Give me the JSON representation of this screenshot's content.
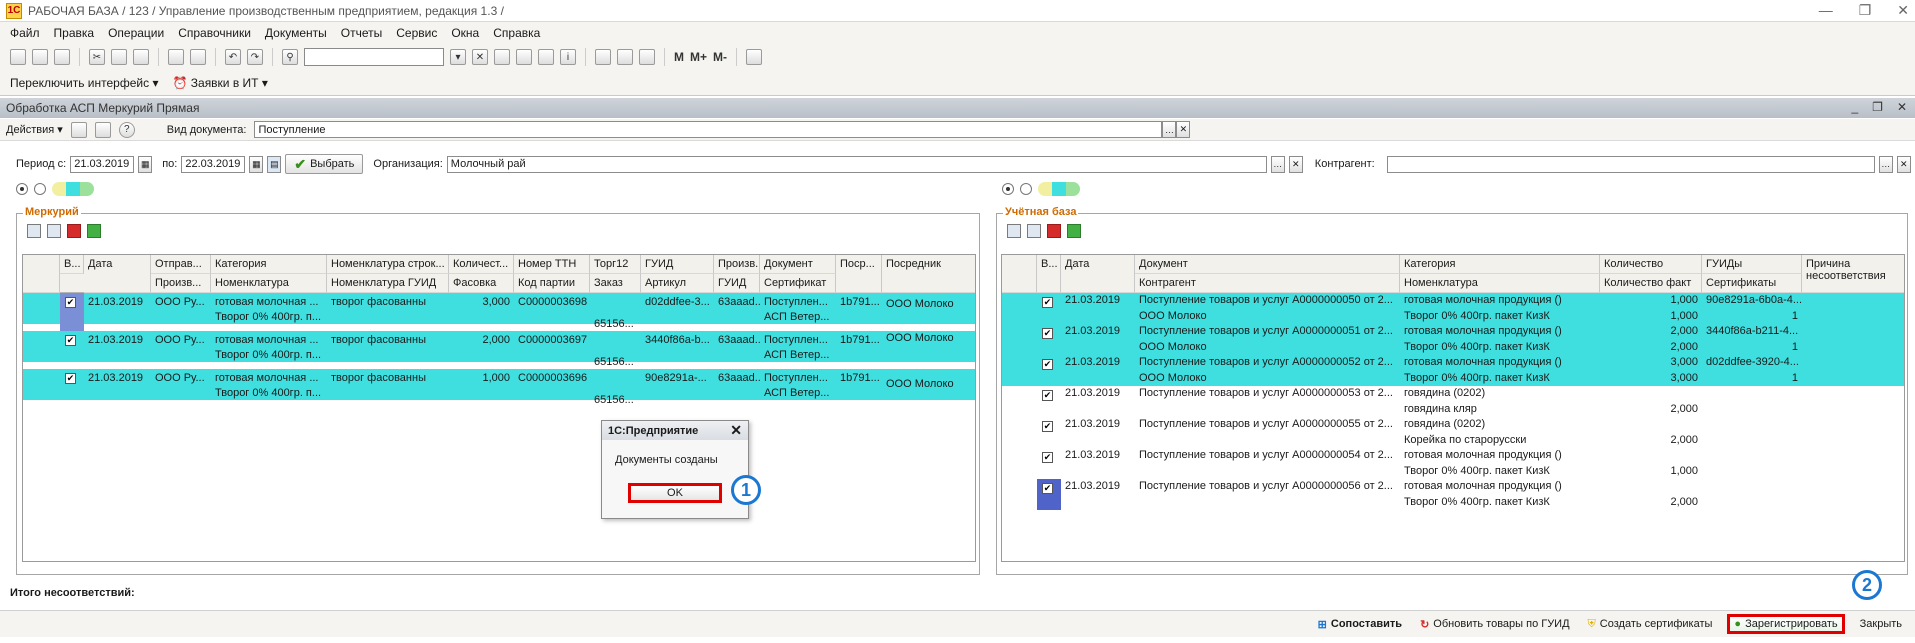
{
  "app": {
    "title": "РАБОЧАЯ БАЗА / 123 /  Управление производственным предприятием, редакция 1.3 /",
    "logo": "1С"
  },
  "menu": [
    "Файл",
    "Правка",
    "Операции",
    "Справочники",
    "Документы",
    "Отчеты",
    "Сервис",
    "Окна",
    "Справка"
  ],
  "toolbar2": {
    "switch_interface": "Переключить интерфейс",
    "requests_it": "Заявки в ИТ"
  },
  "toolbar_letters": [
    "M",
    "M+",
    "M-"
  ],
  "window": {
    "title": "Обработка  АСП Меркурий Прямая"
  },
  "actions": {
    "label": "Действия",
    "doc_type_label": "Вид документа:",
    "doc_type_value": "Поступление"
  },
  "period": {
    "from_label": "Период с:",
    "from_value": "21.03.2019",
    "to_label": "по:",
    "to_value": "22.03.2019",
    "select_button": "Выбрать",
    "org_label": "Организация:",
    "org_value": "Молочный рай",
    "contractor_label": "Контрагент:",
    "contractor_value": ""
  },
  "mercury": {
    "title": "Меркурий",
    "header_row1": [
      "В...",
      "Дата",
      "Отправ...",
      "Категория",
      "Номенклатура строк...",
      "Количест...",
      "Номер ТТН",
      "Торг12",
      "ГУИД",
      "Произв...",
      "Документ",
      "Поср...",
      "Посредник"
    ],
    "header_row2": [
      "Произв...",
      "Номенклатура",
      "Номенклатура ГУИД",
      "Фасовка",
      "Код партии",
      "Заказ",
      "Артикул",
      "ГУИД",
      "Сертификат"
    ],
    "rows": [
      {
        "date": "21.03.2019",
        "sender": "ООО Ру...",
        "category": "готовая молочная ...",
        "nom_str": "творог фасованны",
        "qty": "3,000",
        "ttn": "C0000003698",
        "guid": "d02ddfee-3...",
        "prod": "63aaad...",
        "doc": "Поступлен...",
        "posr": "1b791...",
        "mediator": "ООО Молоко",
        "nom": "Творог 0% 400гр. п...",
        "order": "65156...",
        "cert": "АСП Ветер..."
      },
      {
        "date": "21.03.2019",
        "sender": "ООО Ру...",
        "category": "готовая молочная ...",
        "nom_str": "творог фасованны",
        "qty": "2,000",
        "ttn": "C0000003697",
        "guid": "3440f86a-b...",
        "prod": "63aaad...",
        "doc": "Поступлен...",
        "posr": "1b791...",
        "mediator": "ООО Молоко",
        "nom": "Творог 0% 400гр. п...",
        "order": "65156...",
        "cert": "АСП Ветер..."
      },
      {
        "date": "21.03.2019",
        "sender": "ООО Ру...",
        "category": "готовая молочная ...",
        "nom_str": "творог фасованны",
        "qty": "1,000",
        "ttn": "C0000003696",
        "guid": "90e8291a-...",
        "prod": "63aaad...",
        "doc": "Поступлен...",
        "posr": "1b791...",
        "mediator": "ООО Молоко",
        "nom": "Творог 0% 400гр. п...",
        "order": "65156...",
        "cert": "АСП Ветер..."
      }
    ]
  },
  "accounting": {
    "title": "Учётная база",
    "header_row1": [
      "В...",
      "Дата",
      "Документ",
      "Категория",
      "Количество",
      "ГУИДы",
      "Причина несоответствия"
    ],
    "header_row2": [
      "Контрагент",
      "Номенклатура",
      "Количество факт",
      "Сертификаты"
    ],
    "rows": [
      {
        "date": "21.03.2019",
        "doc": "Поступление товаров и услуг А0000000050 от 2...",
        "category": "готовая молочная продукция ()",
        "qty": "1,000",
        "guid": "90e8291a-6b0a-4...",
        "contractor": "ООО Молоко",
        "nom": "Творог 0% 400гр. пакет КизК",
        "qty_fact": "1,000",
        "cert": "1",
        "hl": true,
        "checked": true
      },
      {
        "date": "21.03.2019",
        "doc": "Поступление товаров и услуг А0000000051 от 2...",
        "category": "готовая молочная продукция ()",
        "qty": "2,000",
        "guid": "3440f86a-b211-4...",
        "contractor": "ООО Молоко",
        "nom": "Творог 0% 400гр. пакет КизК",
        "qty_fact": "2,000",
        "cert": "1",
        "hl": true,
        "checked": true
      },
      {
        "date": "21.03.2019",
        "doc": "Поступление товаров и услуг А0000000052 от 2...",
        "category": "готовая молочная продукция ()",
        "qty": "3,000",
        "guid": "d02ddfee-3920-4...",
        "contractor": "ООО Молоко",
        "nom": "Творог 0% 400гр. пакет КизК",
        "qty_fact": "3,000",
        "cert": "1",
        "hl": true,
        "checked": true
      },
      {
        "date": "21.03.2019",
        "doc": "Поступление товаров и услуг А0000000053 от 2...",
        "category": "говядина (0202)",
        "qty": "",
        "guid": "",
        "contractor": "",
        "nom": "говядина кляр",
        "qty_fact": "2,000",
        "cert": "",
        "hl": false,
        "checked": true
      },
      {
        "date": "21.03.2019",
        "doc": "Поступление товаров и услуг А0000000055 от 2...",
        "category": "говядина (0202)",
        "qty": "",
        "guid": "",
        "contractor": "",
        "nom": "Корейка по старорусски",
        "qty_fact": "2,000",
        "cert": "",
        "hl": false,
        "checked": true
      },
      {
        "date": "21.03.2019",
        "doc": "Поступление товаров и услуг А0000000054 от 2...",
        "category": "готовая молочная продукция ()",
        "qty": "",
        "guid": "",
        "contractor": "",
        "nom": "Творог 0% 400гр. пакет КизК",
        "qty_fact": "1,000",
        "cert": "",
        "hl": false,
        "checked": true
      },
      {
        "date": "21.03.2019",
        "doc": "Поступление товаров и услуг А0000000056 от 2...",
        "category": "готовая молочная продукция ()",
        "qty": "",
        "guid": "",
        "contractor": "",
        "nom": "Творог 0% 400гр. пакет КизК",
        "qty_fact": "2,000",
        "cert": "",
        "hl": false,
        "checked": true
      }
    ]
  },
  "dialog": {
    "title": "1С:Предприятие",
    "message": "Документы созданы",
    "ok": "OK"
  },
  "badges": [
    "1",
    "2"
  ],
  "total_label": "Итого несоответствий:",
  "bottom": {
    "match": "Сопоставить",
    "update_guid": "Обновить товары по ГУИД",
    "create_certs": "Создать сертификаты",
    "register": "Зарегистрировать",
    "close": "Закрыть"
  },
  "colors": {
    "highlight": "#3fdfe0",
    "alert_red": "#e00000",
    "badge_blue": "#1a77d2",
    "panel_title": "#d06b00"
  }
}
